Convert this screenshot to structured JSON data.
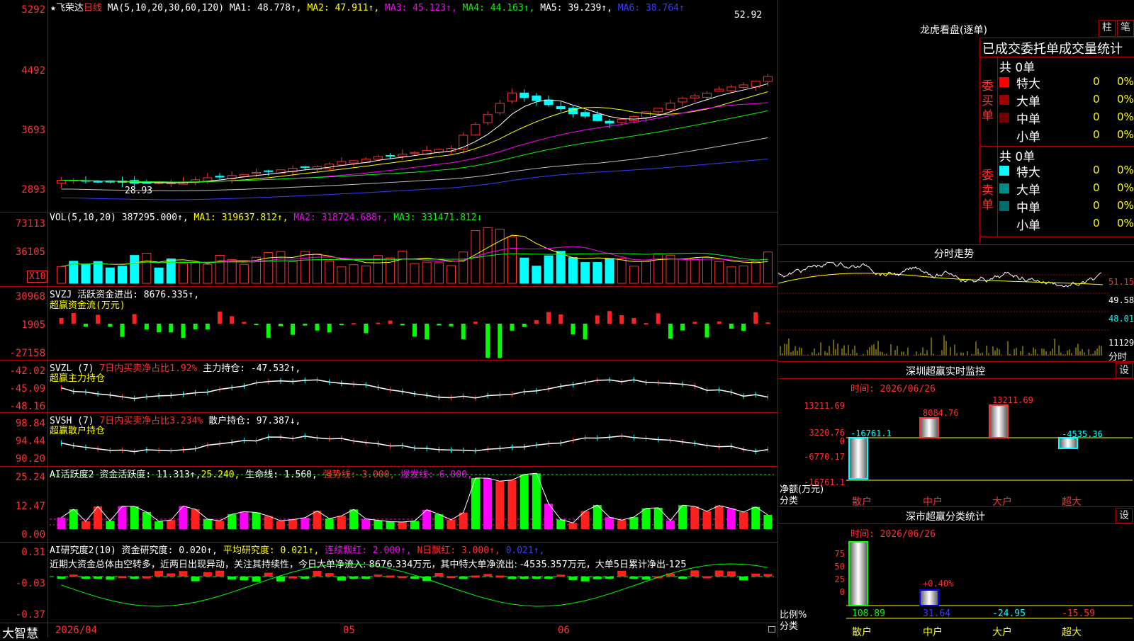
{
  "app_name": "大智慧",
  "kline": {
    "star": "★",
    "stock_name": "飞荣达",
    "period": "日线",
    "ma_title": "MA(5,10,20,30,60,120)",
    "ma1": "MA1: 48.778↑,",
    "ma2": "MA2: 47.911↑,",
    "ma3": "MA3: 45.123↑,",
    "ma4": "MA4: 44.163↑,",
    "ma5": "MA5: 39.239↑,",
    "ma6": "MA6: 38.764↑",
    "high_marker": "52.92",
    "low_marker": "28.93",
    "y_ticks": [
      "5292",
      "4492",
      "3693",
      "2893"
    ]
  },
  "volume": {
    "title": "VOL(5,10,20)",
    "value": "387295.000↑,",
    "ma1": "MA1: 319637.812↑,",
    "ma2": "MA2: 318724.688↑,",
    "ma3": "MA3: 331471.812↓",
    "y_ticks": [
      "73113",
      "36105"
    ],
    "unit_badge": "X10"
  },
  "svzj": {
    "title": "SVZJ",
    "label": "活跃资金进出: 8676.335↑,",
    "subtitle": "超赢资金流(万元)",
    "y_ticks": [
      "30968",
      "1905",
      "-27158"
    ]
  },
  "svzl": {
    "title": "SVZL (7)",
    "label1": "7日内买卖净占比1.92%",
    "label2": "主力持仓: -47.532↑,",
    "subtitle": "超赢主力持仓",
    "y_ticks": [
      "-42.02",
      "-45.09",
      "-48.16"
    ]
  },
  "svsh": {
    "title": "SVSH (7)",
    "label1": "7日内买卖净占比3.234%",
    "label2": "散户持仓: 97.387↓,",
    "subtitle": "超赢散户持仓",
    "y_ticks": [
      "98.84",
      "94.44",
      "90.20"
    ]
  },
  "ai_active": {
    "title": "AI活跃度2",
    "label1": "资金活跃度: 11.313↑,",
    "label2": "25.240,",
    "label3": "生命线: 1.560,",
    "label4": "强势线: 3.000,",
    "label5": "爆发线: 6.000,",
    "y_ticks": [
      "25.24",
      "12.47",
      "0.00"
    ]
  },
  "ai_research": {
    "title": "AI研究度2(10)",
    "label1": "资金研究度: 0.020↑,",
    "label2": "平均研究度: 0.021↑,",
    "label3": "连续飘红: 2.000↑,",
    "label4": "N日飘红: 3.000↑,",
    "label5": "0.021↑,",
    "comment": "近期大资金总体由空转多，近两日出现异动，关注其持续性，今日大单净流入: 8676.334万元，其中特大单净流出: -4535.357万元，大单5日累计净出-125",
    "y_ticks": [
      "0.31",
      "-0.03",
      "-0.37"
    ]
  },
  "x_axis": {
    "labels": [
      "2026/04",
      "05",
      "06"
    ]
  },
  "dragon_tiger": {
    "title": "龙虎看盘(逐单)",
    "btn_bar": "柱",
    "btn_stroke": "笔",
    "header": "已成交委托单成交量统计",
    "buy_side": "委买单",
    "sell_side": "委卖单",
    "buy_total": "共 0单",
    "sell_total": "共 0单",
    "buy_rows": [
      {
        "label": "特大",
        "count": "0",
        "pct": "0%",
        "color": "#ff0000"
      },
      {
        "label": "大单",
        "count": "0",
        "pct": "0%",
        "color": "#a00000"
      },
      {
        "label": "中单",
        "count": "0",
        "pct": "0%",
        "color": "#700000"
      },
      {
        "label": "小单",
        "count": "0",
        "pct": "0%",
        "color": ""
      }
    ],
    "sell_rows": [
      {
        "label": "特大",
        "count": "0",
        "pct": "0%",
        "color": "#00ffff"
      },
      {
        "label": "大单",
        "count": "0",
        "pct": "0%",
        "color": "#008b8b"
      },
      {
        "label": "中单",
        "count": "0",
        "pct": "0%",
        "color": "#006b6b"
      },
      {
        "label": "小单",
        "count": "0",
        "pct": "0%",
        "color": ""
      }
    ]
  },
  "intraday": {
    "title": "分时走势",
    "prices": [
      "51.15",
      "49.58",
      "48.01"
    ],
    "vol_label": "11129",
    "time_label": "分时"
  },
  "monitor": {
    "title": "深圳超赢实时监控",
    "settings": "设",
    "date": "时间: 2026/06/26",
    "y_ticks": [
      "13211.69",
      "3220.76",
      "0",
      "-6770.17",
      "-16761.1"
    ],
    "bars": [
      {
        "cat": "散户",
        "value": "-16761.1"
      },
      {
        "cat": "中户",
        "value": "8084.76"
      },
      {
        "cat": "大户",
        "value": "13211.69"
      },
      {
        "cat": "超大",
        "value": "-4535.36"
      }
    ],
    "ylabel": "净额(万元)",
    "xlabel": "分类"
  },
  "classify": {
    "title": "深市超赢分类统计",
    "settings": "设",
    "date": "时间: 2026/06/26",
    "y_ticks": [
      "75",
      "50",
      "25",
      "0"
    ],
    "bars": [
      {
        "cat": "散户",
        "value": "108.89"
      },
      {
        "cat": "中户",
        "value": "31.64"
      },
      {
        "cat": "大户",
        "value": "-24.95"
      },
      {
        "cat": "超大",
        "value": "-15.59"
      }
    ],
    "bar_label": "+0.40%",
    "ylabel": "比例%",
    "xlabel": "分类"
  },
  "colors": {
    "grid": "#b00000",
    "up": "#ff3232",
    "down": "#00ffff",
    "green": "#00ff00",
    "magenta": "#ff00ff"
  }
}
